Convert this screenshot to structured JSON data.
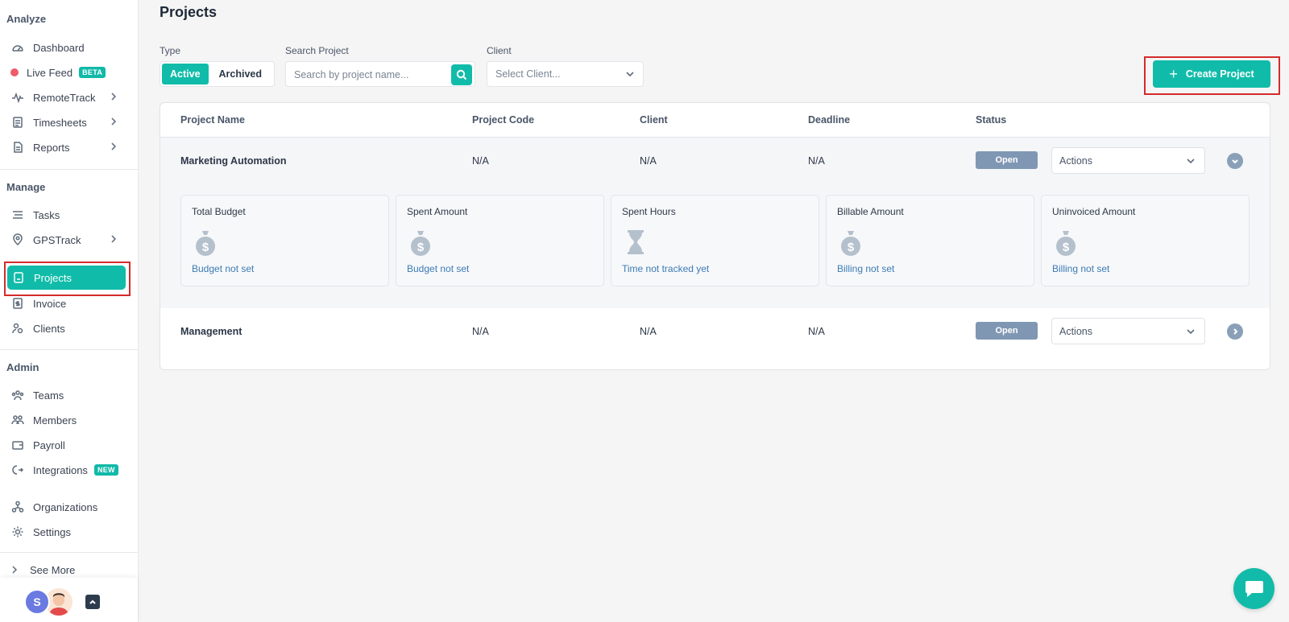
{
  "sidebar": {
    "sections": {
      "analyze": "Analyze",
      "manage": "Manage",
      "admin": "Admin"
    },
    "items": {
      "dashboard": "Dashboard",
      "live_feed": "Live Feed",
      "live_feed_badge": "BETA",
      "remotetrack": "RemoteTrack",
      "timesheets": "Timesheets",
      "reports": "Reports",
      "tasks": "Tasks",
      "gpstrack": "GPSTrack",
      "projects": "Projects",
      "invoice": "Invoice",
      "clients": "Clients",
      "teams": "Teams",
      "members": "Members",
      "payroll": "Payroll",
      "integrations": "Integrations",
      "integrations_badge": "NEW",
      "organizations": "Organizations",
      "settings": "Settings",
      "see_more": "See More"
    },
    "user": {
      "initial": "S"
    }
  },
  "main": {
    "title": "Projects",
    "filters": {
      "type_label": "Type",
      "type_active": "Active",
      "type_archived": "Archived",
      "search_label": "Search Project",
      "search_placeholder": "Search by project name...",
      "client_label": "Client",
      "client_placeholder": "Select Client..."
    },
    "create_button": "Create Project",
    "table": {
      "headers": {
        "name": "Project Name",
        "code": "Project Code",
        "client": "Client",
        "deadline": "Deadline",
        "status": "Status"
      },
      "rows": [
        {
          "name": "Marketing Automation",
          "code": "N/A",
          "client": "N/A",
          "deadline": "N/A",
          "status": "Open",
          "actions": "Actions",
          "cards": [
            {
              "title": "Total Budget",
              "icon": "money-bag-icon",
              "status": "Budget not set"
            },
            {
              "title": "Spent Amount",
              "icon": "money-bag-icon",
              "status": "Budget not set"
            },
            {
              "title": "Spent Hours",
              "icon": "hourglass-icon",
              "status": "Time not tracked yet"
            },
            {
              "title": "Billable Amount",
              "icon": "money-bag-icon",
              "status": "Billing not set"
            },
            {
              "title": "Uninvoiced Amount",
              "icon": "money-bag-icon",
              "status": "Billing not set"
            }
          ]
        },
        {
          "name": "Management",
          "code": "N/A",
          "client": "N/A",
          "deadline": "N/A",
          "status": "Open",
          "actions": "Actions"
        }
      ]
    }
  },
  "colors": {
    "accent": "#10bca9",
    "status_pill": "#7f97b3",
    "link": "#3c7bb4",
    "highlight_box": "#d42b2b"
  }
}
